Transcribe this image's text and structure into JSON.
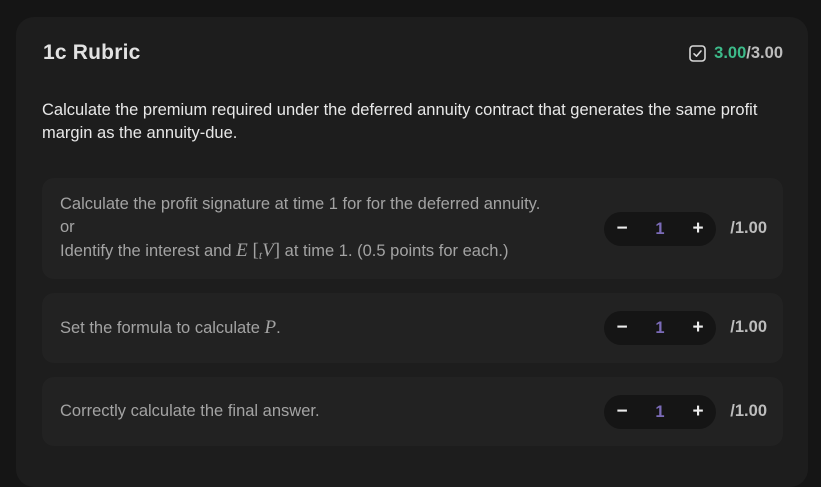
{
  "rubric": {
    "title": "1c Rubric",
    "score_value": "3.00",
    "score_total": "/3.00",
    "status_icon": "checkbox-check-icon",
    "accent_color": "#3dbb8a",
    "question": "Calculate the premium required under the deferred annuity contract that generates the same profit margin as the annuity-due."
  },
  "items": [
    {
      "line1": "Calculate the profit signature at time 1 for for the deferred annuity.",
      "line2": "or",
      "line3_pre": "Identify the interest and ",
      "math_E": "E",
      "math_lbr": "[",
      "math_sub": "t",
      "math_V": "V",
      "math_rbr": "]",
      "line3_post": " at time 1. (0.5 points for each.)",
      "minus": "−",
      "value": "1",
      "plus": "+",
      "max": "/1.00"
    },
    {
      "text_pre": "Set the formula to calculate ",
      "math_P": "P",
      "text_post": ".",
      "minus": "−",
      "value": "1",
      "plus": "+",
      "max": "/1.00"
    },
    {
      "text": "Correctly calculate the final answer.",
      "minus": "−",
      "value": "1",
      "plus": "+",
      "max": "/1.00"
    }
  ]
}
